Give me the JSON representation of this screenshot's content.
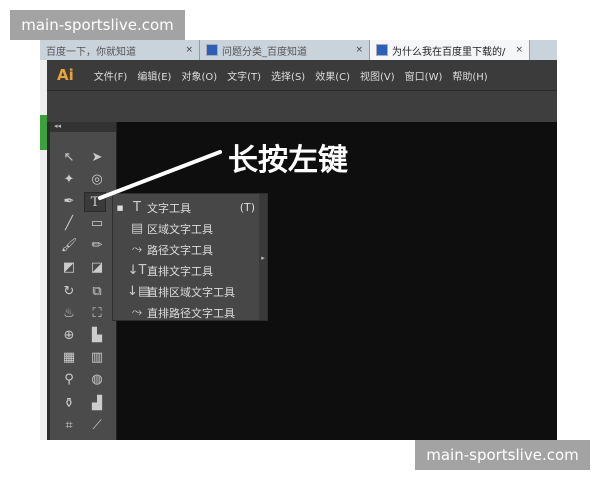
{
  "browser": {
    "tabs": [
      {
        "label": "百度一下，你就知道",
        "active": false
      },
      {
        "label": "问题分类_百度知道",
        "active": false
      },
      {
        "label": "为什么我在百度里下载的/",
        "active": true
      }
    ]
  },
  "app": {
    "logo": "Ai",
    "menu": [
      "文件(F)",
      "编辑(E)",
      "对象(O)",
      "文字(T)",
      "选择(S)",
      "效果(C)",
      "视图(V)",
      "窗口(W)",
      "帮助(H)"
    ]
  },
  "toolbox": {
    "collapse": "◂◂"
  },
  "flyout": {
    "items": [
      {
        "icon": "T",
        "label": "文字工具",
        "shortcut": "(T)",
        "selected": true
      },
      {
        "icon": "▤",
        "label": "区域文字工具"
      },
      {
        "icon": "⤳",
        "label": "路径文字工具"
      },
      {
        "icon": "↓T",
        "label": "直排文字工具"
      },
      {
        "icon": "↓▤",
        "label": "直排区域文字工具"
      },
      {
        "icon": "⤳",
        "label": "直排路径文字工具"
      }
    ]
  },
  "annotation": "长按左键",
  "watermarks": [
    "main-sportslive.com",
    "main-sportslive.com"
  ]
}
